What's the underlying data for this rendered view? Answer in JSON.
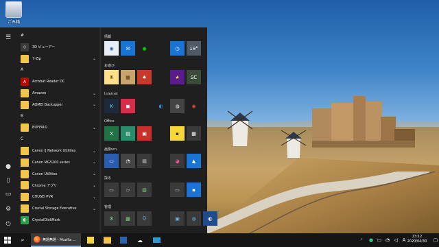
{
  "desktop": {
    "recycle_bin_label": "ごみ箱"
  },
  "start_menu": {
    "rail": [
      {
        "name": "menu-icon",
        "glyph": "☰"
      },
      {
        "name": "user-avatar-icon",
        "glyph": "●"
      },
      {
        "name": "document-icon",
        "glyph": "▯"
      },
      {
        "name": "pictures-icon",
        "glyph": "▭"
      },
      {
        "name": "settings-icon",
        "glyph": "⚙"
      },
      {
        "name": "power-icon",
        "glyph": "⏻"
      }
    ],
    "apps": [
      {
        "kind": "letter",
        "text": "#"
      },
      {
        "kind": "app",
        "label": "3D ビューアー",
        "icon": "cube-icon",
        "color": "#3a3a3a",
        "glyph": "◇",
        "chev": ""
      },
      {
        "kind": "app",
        "label": "7-Zip",
        "icon": "folder-icon",
        "color": "#f2c64b",
        "glyph": "",
        "chev": "⌄"
      },
      {
        "kind": "letter",
        "text": "A"
      },
      {
        "kind": "app",
        "label": "Acrobat Reader DC",
        "icon": "acrobat-icon",
        "color": "#b30b00",
        "glyph": "A",
        "chev": ""
      },
      {
        "kind": "app",
        "label": "Amazon",
        "icon": "folder-icon",
        "color": "#f2c64b",
        "glyph": "",
        "chev": "⌄"
      },
      {
        "kind": "app",
        "label": "AOMEI Backupper",
        "icon": "folder-icon",
        "color": "#f2c64b",
        "glyph": "",
        "chev": "⌄"
      },
      {
        "kind": "letter",
        "text": "B"
      },
      {
        "kind": "app",
        "label": "BUFFALO",
        "icon": "folder-icon",
        "color": "#f2c64b",
        "glyph": "",
        "chev": "⌄"
      },
      {
        "kind": "letter",
        "text": "C"
      },
      {
        "kind": "app",
        "label": "Canon IJ Network Utilities",
        "icon": "folder-icon",
        "color": "#f2c64b",
        "glyph": "",
        "chev": "⌄"
      },
      {
        "kind": "app",
        "label": "Canon MG5200 series",
        "icon": "folder-icon",
        "color": "#f2c64b",
        "glyph": "",
        "chev": "⌄"
      },
      {
        "kind": "app",
        "label": "Canon Utilities",
        "icon": "folder-icon",
        "color": "#f2c64b",
        "glyph": "",
        "chev": "⌄"
      },
      {
        "kind": "app",
        "label": "Chrome アプリ",
        "icon": "folder-icon",
        "color": "#f2c64b",
        "glyph": "",
        "chev": "⌄"
      },
      {
        "kind": "app",
        "label": "CHUSEI PVR",
        "icon": "folder-icon",
        "color": "#f2c64b",
        "glyph": "",
        "chev": "⌄"
      },
      {
        "kind": "app",
        "label": "Crucial Storage Executive",
        "icon": "folder-icon",
        "color": "#f2c64b",
        "glyph": "",
        "chev": "⌄"
      },
      {
        "kind": "app",
        "label": "CrystalDiskMark",
        "icon": "crystaldiskmark-icon",
        "color": "#2e9b4c",
        "glyph": "◐",
        "chev": ""
      }
    ],
    "groups": [
      {
        "label": "情報",
        "tiles": [
          {
            "name": "cortana-tile",
            "color": "#e8eef6",
            "glyph": "◉",
            "fg": "#2a62b0"
          },
          {
            "name": "mail-tile",
            "color": "#1a74d4",
            "glyph": "✉",
            "fg": "#fff"
          },
          {
            "name": "line-tile",
            "color": "#1f1f1f",
            "glyph": "●",
            "fg": "#00c300"
          },
          {
            "name": "",
            "color": "",
            "glyph": "",
            "fg": ""
          },
          {
            "name": "alarm-clock-tile",
            "color": "#1a74d4",
            "glyph": "◷",
            "fg": "#fff"
          },
          {
            "name": "weather-tile",
            "color": "#4e5a66",
            "glyph": "19°",
            "fg": "#fff"
          }
        ]
      },
      {
        "label": "お遊び",
        "tiles": [
          {
            "name": "game-tile-1",
            "color": "#ffe08a",
            "glyph": "♜",
            "fg": "#7a5a1a"
          },
          {
            "name": "game-tile-2",
            "color": "#c9a46b",
            "glyph": "▦",
            "fg": "#4a3010"
          },
          {
            "name": "solitaire-tile",
            "color": "#c43b2b",
            "glyph": "♠",
            "fg": "#fff"
          },
          {
            "name": "",
            "color": "",
            "glyph": "",
            "fg": ""
          },
          {
            "name": "pinball-star-tile",
            "color": "#5a1b8c",
            "glyph": "★",
            "fg": "#f5e05a"
          },
          {
            "name": "game-tile-sc",
            "color": "#3b4b3b",
            "glyph": "SC",
            "fg": "#fff"
          }
        ]
      },
      {
        "label": "Internet",
        "tiles": [
          {
            "name": "k-app-tile",
            "color": "#1d2a3a",
            "glyph": "K",
            "fg": "#6fd0ff"
          },
          {
            "name": "news-tile",
            "color": "#d62d4a",
            "glyph": "◼",
            "fg": "#fff"
          },
          {
            "name": "",
            "color": "",
            "glyph": "",
            "fg": ""
          },
          {
            "name": "edge-tile",
            "color": "#1f1f1f",
            "glyph": "◐",
            "fg": "#2fa6e6"
          },
          {
            "name": "network-tile",
            "color": "#444",
            "glyph": "◍",
            "fg": "#eee"
          },
          {
            "name": "chrome-tile",
            "color": "#1f1f1f",
            "glyph": "◉",
            "fg": "#e64a3a"
          }
        ]
      },
      {
        "label": "Office",
        "tiles": [
          {
            "name": "excel-tile",
            "color": "#217346",
            "glyph": "X",
            "fg": "#fff"
          },
          {
            "name": "document-tile",
            "color": "#2a8c6b",
            "glyph": "▤",
            "fg": "#fff"
          },
          {
            "name": "pdf-tile",
            "color": "#c9302c",
            "glyph": "▣",
            "fg": "#fff"
          },
          {
            "name": "",
            "color": "",
            "glyph": "",
            "fg": ""
          },
          {
            "name": "sticky-notes-tile",
            "color": "#f6d73a",
            "glyph": "▪",
            "fg": "#333"
          },
          {
            "name": "calculator-tile",
            "color": "#3a3a3a",
            "glyph": "▦",
            "fg": "#fff"
          }
        ]
      },
      {
        "label": "画像um.",
        "tiles": [
          {
            "name": "image-app-tile-1",
            "color": "#2a5cb0",
            "glyph": "▭",
            "fg": "#fff"
          },
          {
            "name": "penguin-tile",
            "color": "#444",
            "glyph": "◔",
            "fg": "#fff"
          },
          {
            "name": "image-app-tile-3",
            "color": "#3a3a3a",
            "glyph": "▥",
            "fg": "#ddd"
          },
          {
            "name": "",
            "color": "",
            "glyph": "",
            "fg": ""
          },
          {
            "name": "paint-tile",
            "color": "#3a3a3a",
            "glyph": "◕",
            "fg": "#e65a9a"
          },
          {
            "name": "photos-tile",
            "color": "#1a74d4",
            "glyph": "▲",
            "fg": "#fff"
          }
        ]
      },
      {
        "label": "採る",
        "tiles": [
          {
            "name": "capture-tile-1",
            "color": "#3a3a3a",
            "glyph": "▭",
            "fg": "#ccc"
          },
          {
            "name": "capture-tile-2",
            "color": "#3a3a3a",
            "glyph": "▱",
            "fg": "#ccc"
          },
          {
            "name": "capture-tile-3",
            "color": "#3a3a3a",
            "glyph": "▨",
            "fg": "#7bd07b"
          },
          {
            "name": "",
            "color": "",
            "glyph": "",
            "fg": ""
          },
          {
            "name": "capture-tile-4",
            "color": "#3a3a3a",
            "glyph": "▭",
            "fg": "#ccc"
          },
          {
            "name": "screen-sketch-tile",
            "color": "#1a74d4",
            "glyph": "▪",
            "fg": "#fff"
          }
        ]
      },
      {
        "label": "管理",
        "tiles": [
          {
            "name": "admin-tile-1",
            "color": "#3a3a3a",
            "glyph": "⚙",
            "fg": "#7bd0a0"
          },
          {
            "name": "admin-tile-2",
            "color": "#3a3a3a",
            "glyph": "▦",
            "fg": "#7bd07b"
          },
          {
            "name": "admin-tile-3",
            "color": "#3a3a3a",
            "glyph": "⛭",
            "fg": "#6ab0e6"
          },
          {
            "name": "",
            "color": "",
            "glyph": "",
            "fg": ""
          },
          {
            "name": "admin-tile-4",
            "color": "#3a3a3a",
            "glyph": "▣",
            "fg": "#6ab0e6"
          },
          {
            "name": "admin-tile-5",
            "color": "#3a3a3a",
            "glyph": "◍",
            "fg": "#6ab0e6"
          },
          {
            "name": "admin-tile-6",
            "color": "#1f4b8a",
            "glyph": "◐",
            "fg": "#fff"
          }
        ]
      }
    ]
  },
  "taskbar": {
    "active_window_title": "無題無題 - Mozilla ...",
    "ime_indicator": "A",
    "time": "13:12",
    "date": "2020/04/30"
  }
}
